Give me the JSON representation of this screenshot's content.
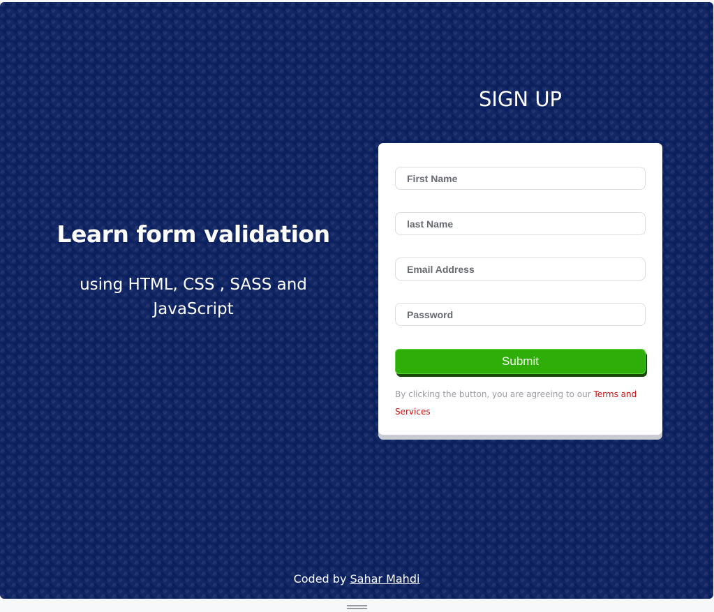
{
  "hero": {
    "title": "Learn form validation",
    "subtitle": "using HTML, CSS , SASS and JavaScript"
  },
  "form": {
    "title": "SIGN UP",
    "fields": [
      {
        "placeholder": "First Name",
        "value": ""
      },
      {
        "placeholder": "last Name",
        "value": ""
      },
      {
        "placeholder": "Email Address",
        "value": ""
      },
      {
        "placeholder": "Password",
        "value": ""
      }
    ],
    "submit_label": "Submit",
    "terms_text": "By clicking the button, you are agreeing to our",
    "terms_link": "Terms and Services"
  },
  "footer": {
    "prefix": "Coded by",
    "author": "Sahar Mahdi"
  },
  "colors": {
    "background": "#0a1f5e",
    "submit": "#2fae0a",
    "terms_link": "#cc1010"
  }
}
